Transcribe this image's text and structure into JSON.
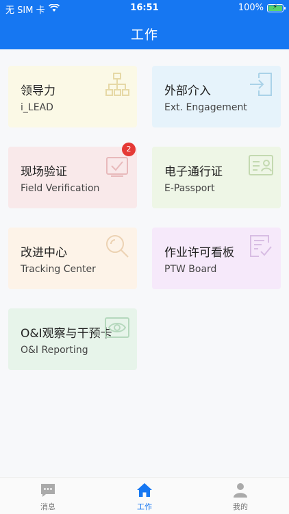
{
  "status": {
    "carrier": "无 SIM 卡",
    "time": "16:51",
    "battery": "100%"
  },
  "header": {
    "title": "工作"
  },
  "cards": [
    {
      "title": "领导力",
      "subtitle": "i_LEAD",
      "icon": "org-chart-icon"
    },
    {
      "title": "外部介入",
      "subtitle": "Ext. Engagement",
      "icon": "enter-door-icon"
    },
    {
      "title": "现场验证",
      "subtitle": "Field Verification",
      "icon": "verify-check-icon",
      "badge": "2"
    },
    {
      "title": "电子通行证",
      "subtitle": "E-Passport",
      "icon": "id-card-icon"
    },
    {
      "title": "改进中心",
      "subtitle": "Tracking Center",
      "icon": "magnifier-icon"
    },
    {
      "title": "作业许可看板",
      "subtitle": "PTW Board",
      "icon": "checklist-board-icon"
    },
    {
      "title": "O&I观察与干预卡",
      "subtitle": "O&I Reporting",
      "icon": "eye-card-icon"
    }
  ],
  "tabs": [
    {
      "label": "消息",
      "icon": "message-icon"
    },
    {
      "label": "工作",
      "icon": "home-icon"
    },
    {
      "label": "我的",
      "icon": "user-icon"
    }
  ],
  "colors": {
    "accent": "#1677f2",
    "badge": "#e53935"
  }
}
